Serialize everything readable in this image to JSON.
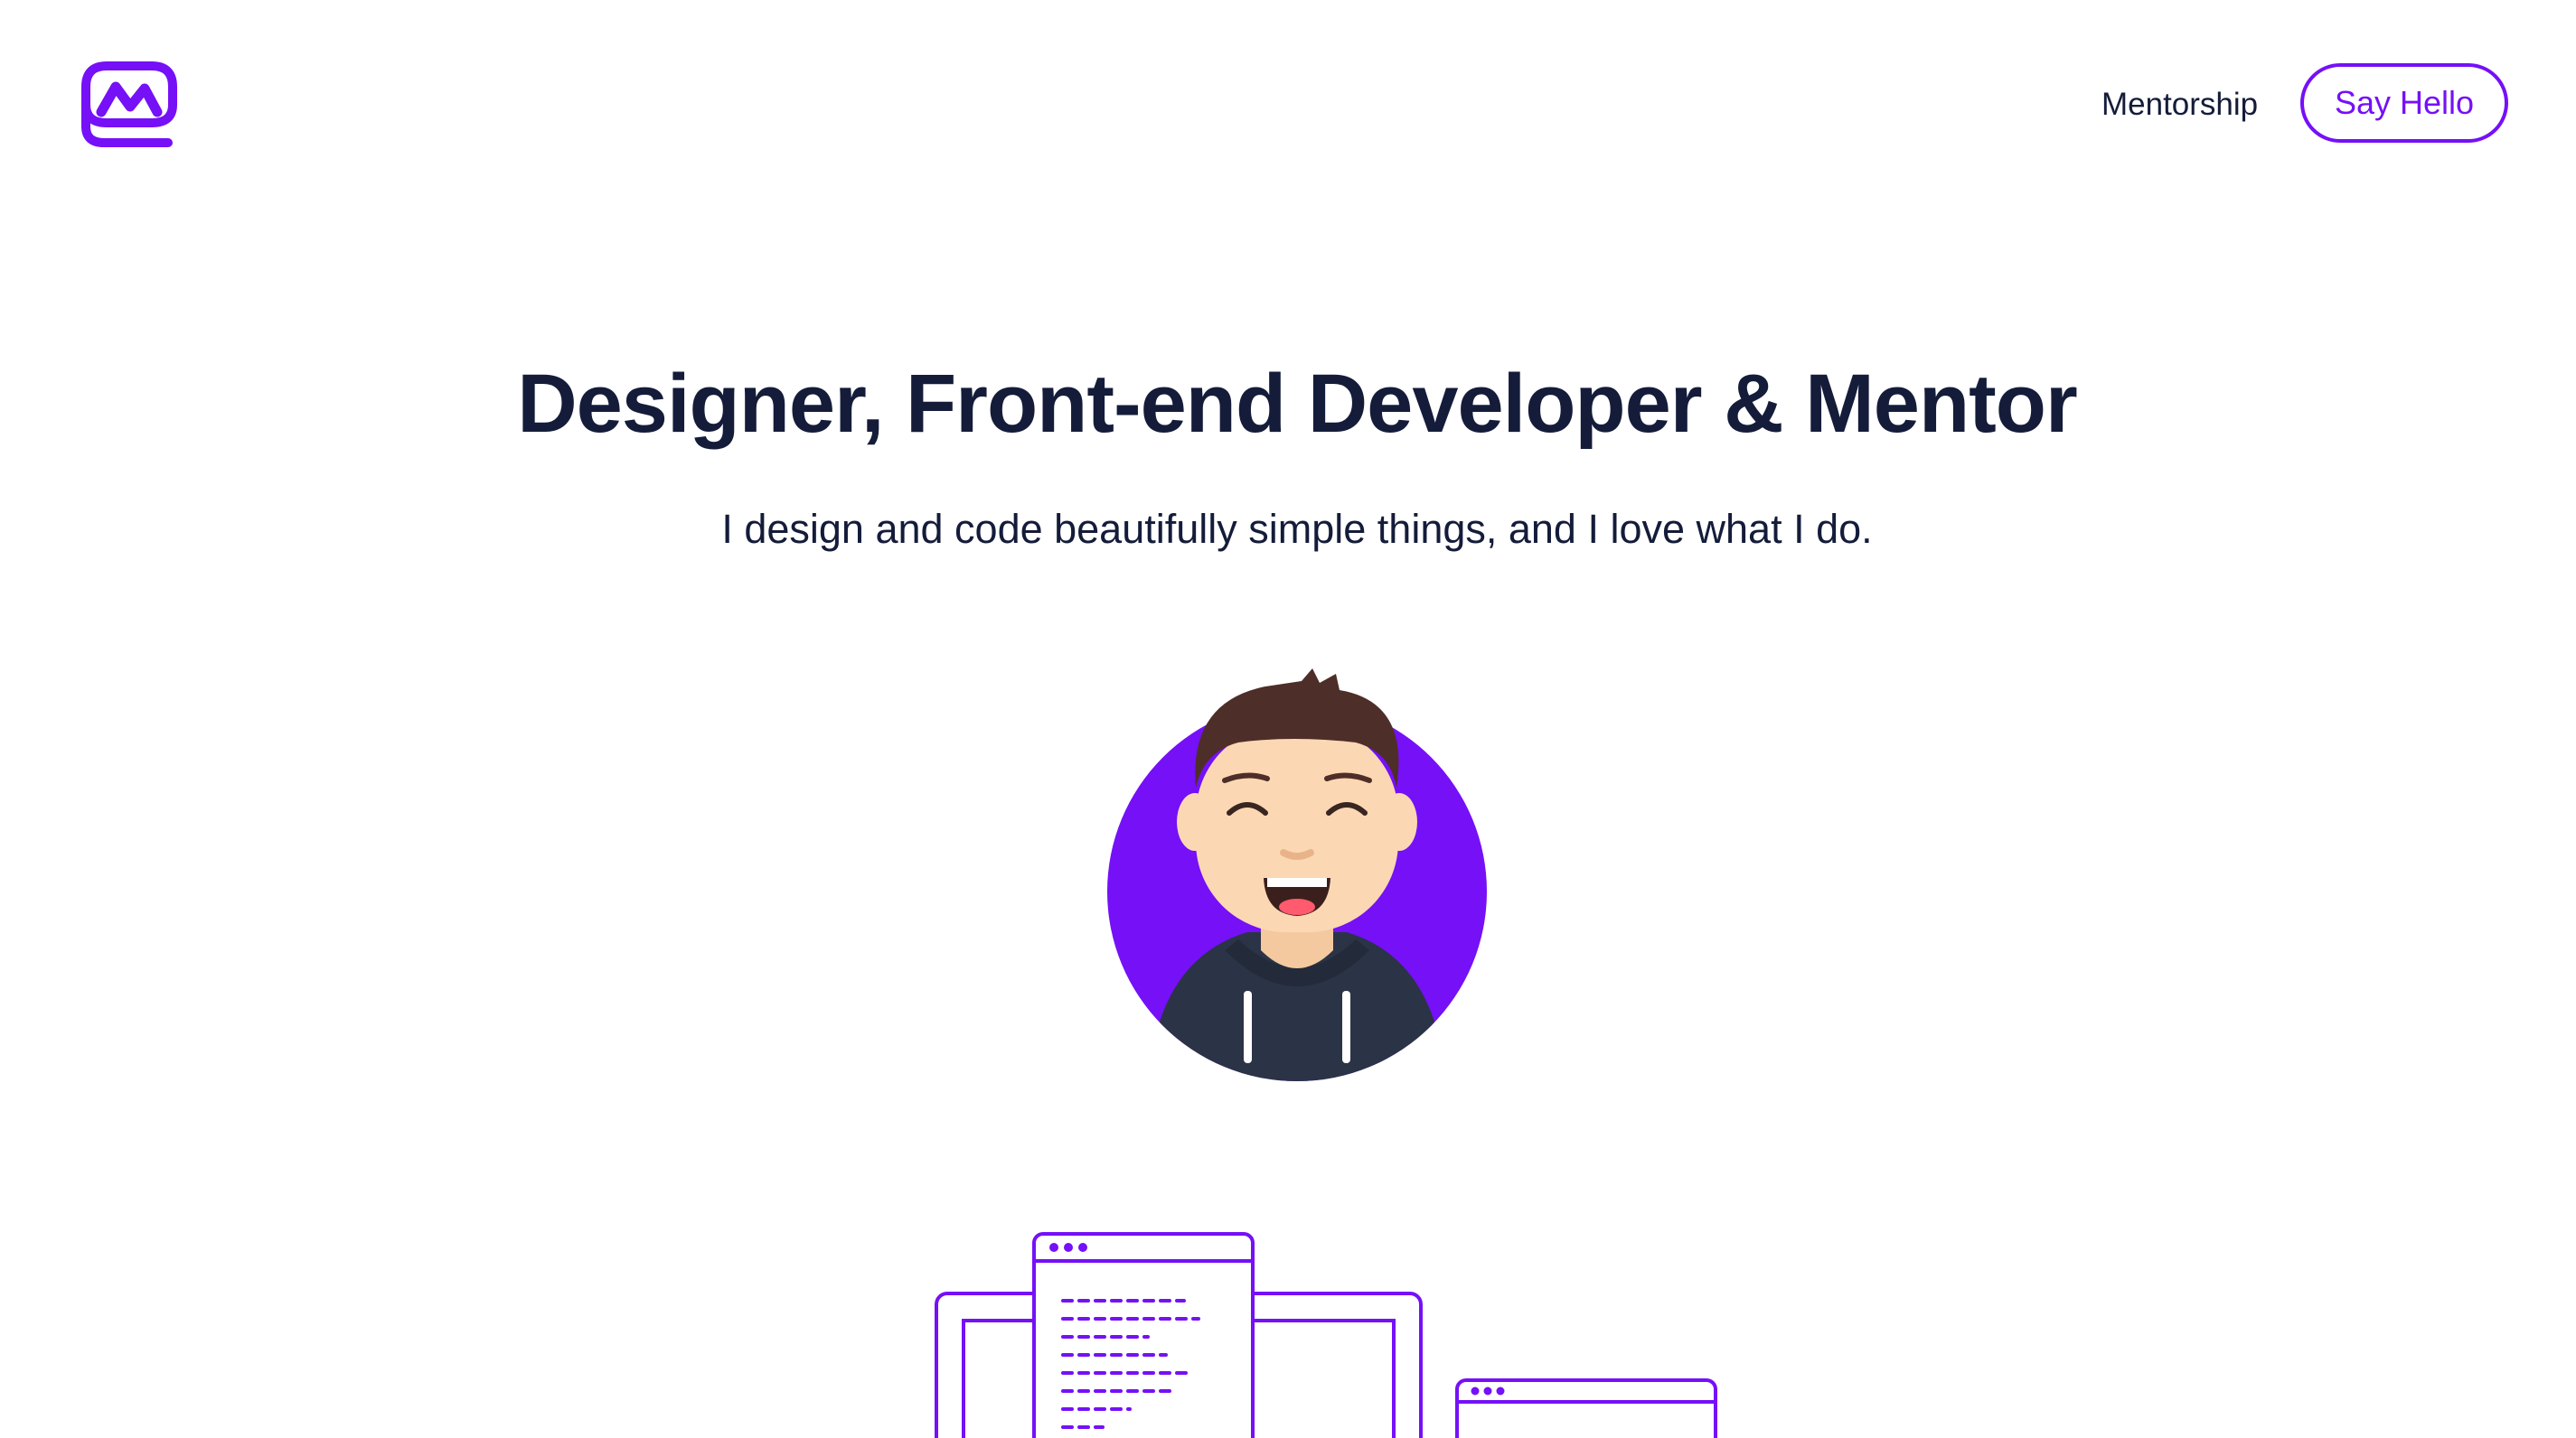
{
  "header": {
    "logo_icon": "mc-monogram-logo",
    "nav": {
      "mentorship_label": "Mentorship",
      "say_hello_label": "Say Hello"
    }
  },
  "hero": {
    "title": "Designer, Front-end Developer & Mentor",
    "subtitle": "I design and code beautifully simple things, and I love what I do.",
    "avatar_icon": "smiling-man-avatar",
    "illustration_icon": "browser-code-windows-illustration"
  },
  "colors": {
    "accent": "#7510f7",
    "text_dark": "#141c3a",
    "background": "#ffffff",
    "hoodie": "#2b3346",
    "skin": "#fbd8b3",
    "hair": "#4e2e28"
  }
}
